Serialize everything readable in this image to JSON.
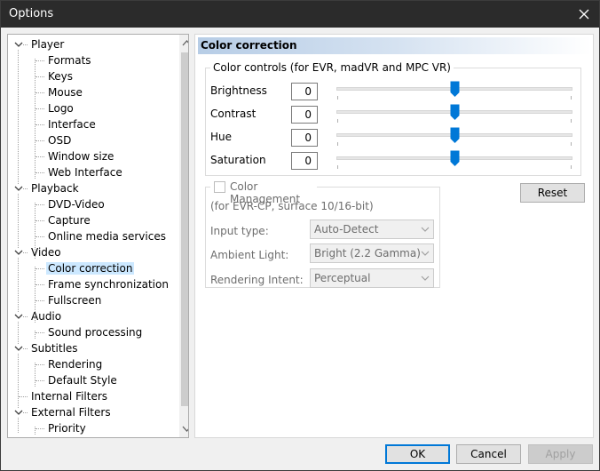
{
  "window": {
    "title": "Options"
  },
  "tree": {
    "items": [
      {
        "label": "Player",
        "expanded": true
      },
      {
        "label": "Formats"
      },
      {
        "label": "Keys"
      },
      {
        "label": "Mouse"
      },
      {
        "label": "Logo"
      },
      {
        "label": "Interface"
      },
      {
        "label": "OSD"
      },
      {
        "label": "Window size"
      },
      {
        "label": "Web Interface"
      },
      {
        "label": "Playback",
        "expanded": true
      },
      {
        "label": "DVD-Video"
      },
      {
        "label": "Capture"
      },
      {
        "label": "Online media services"
      },
      {
        "label": "Video",
        "expanded": true
      },
      {
        "label": "Color correction",
        "selected": true
      },
      {
        "label": "Frame synchronization"
      },
      {
        "label": "Fullscreen"
      },
      {
        "label": "Audio",
        "expanded": true
      },
      {
        "label": "Sound processing"
      },
      {
        "label": "Subtitles",
        "expanded": true
      },
      {
        "label": "Rendering"
      },
      {
        "label": "Default Style"
      },
      {
        "label": "Internal Filters"
      },
      {
        "label": "External Filters",
        "expanded": true
      },
      {
        "label": "Priority"
      }
    ]
  },
  "panel": {
    "header": "Color correction",
    "color_controls": {
      "title": "Color controls (for EVR, madVR and MPC VR)",
      "rows": [
        {
          "label": "Brightness",
          "value": "0",
          "level": 0.5
        },
        {
          "label": "Contrast",
          "value": "0",
          "level": 0.5
        },
        {
          "label": "Hue",
          "value": "0",
          "level": 0.5
        },
        {
          "label": "Saturation",
          "value": "0",
          "level": 0.5
        }
      ]
    },
    "reset_label": "Reset",
    "color_management": {
      "checkbox_label": "Color Management",
      "checked": false,
      "note": "(for EVR-CP, surface 10/16-bit)",
      "input_type_label": "Input type:",
      "input_type_value": "Auto-Detect",
      "ambient_light_label": "Ambient Light:",
      "ambient_light_value": "Bright (2.2 Gamma)",
      "rendering_intent_label": "Rendering Intent:",
      "rendering_intent_value": "Perceptual"
    }
  },
  "buttons": {
    "ok": "OK",
    "cancel": "Cancel",
    "apply": "Apply"
  },
  "colors": {
    "accent": "#0078d7",
    "selection": "#cce8ff",
    "titlebar": "#2b2b2b"
  }
}
